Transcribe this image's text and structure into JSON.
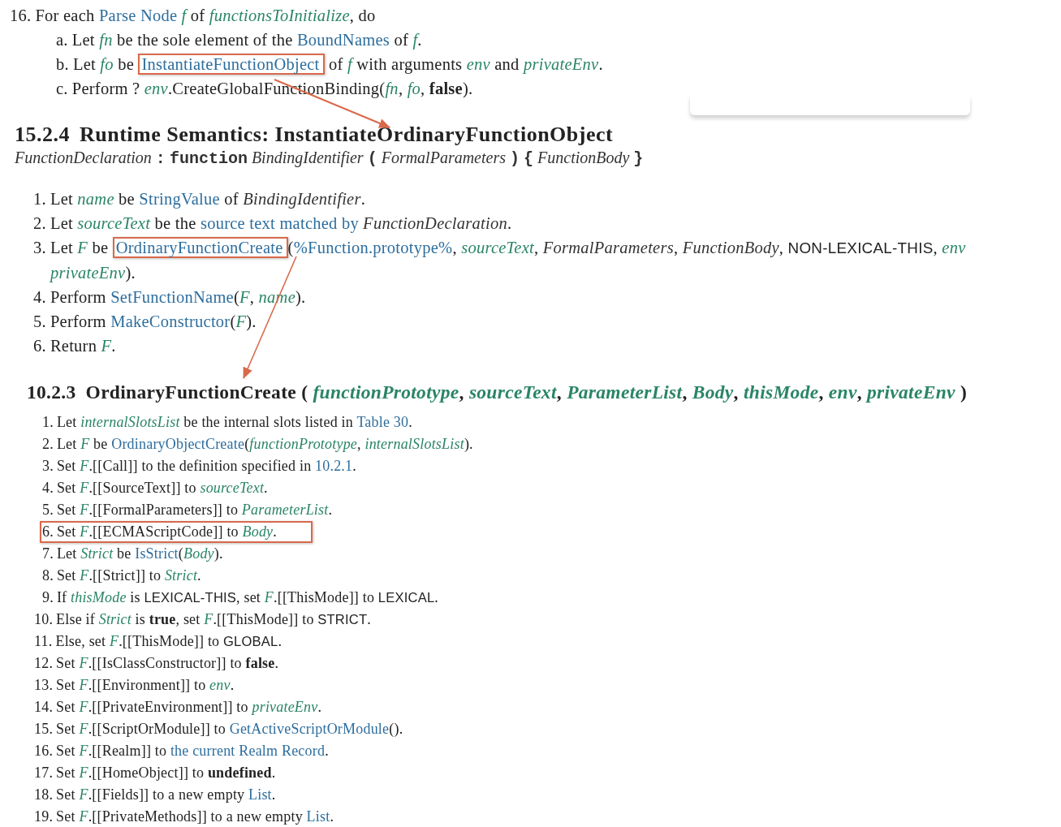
{
  "top_steps": [
    {
      "marker": "16.",
      "segments": [
        {
          "kind": "plain",
          "t": "For each "
        },
        {
          "kind": "link",
          "t": "Parse Node"
        },
        {
          "kind": "var",
          "t": "f",
          "spaced": true
        },
        {
          "kind": "plain",
          "t": " of "
        },
        {
          "kind": "var",
          "t": "functionsToInitialize"
        },
        {
          "kind": "plain",
          "t": ", do"
        }
      ],
      "children": [
        {
          "marker": "a.",
          "segments": [
            {
              "kind": "plain",
              "t": "Let "
            },
            {
              "kind": "var",
              "t": "fn"
            },
            {
              "kind": "plain",
              "t": " be the sole element of the "
            },
            {
              "kind": "link",
              "t": "BoundNames"
            },
            {
              "kind": "plain",
              "t": " of "
            },
            {
              "kind": "var",
              "t": "f"
            },
            {
              "kind": "plain",
              "t": "."
            }
          ]
        },
        {
          "marker": "b.",
          "segments": [
            {
              "kind": "plain",
              "t": "Let "
            },
            {
              "kind": "var",
              "t": "fo"
            },
            {
              "kind": "plain",
              "t": " be "
            },
            {
              "kind": "link",
              "t": "InstantiateFunctionObject",
              "boxed": true
            },
            {
              "kind": "plain",
              "t": " of "
            },
            {
              "kind": "var",
              "t": "f"
            },
            {
              "kind": "plain",
              "t": " with arguments "
            },
            {
              "kind": "var",
              "t": "env"
            },
            {
              "kind": "plain",
              "t": " and "
            },
            {
              "kind": "var",
              "t": "privateEnv"
            },
            {
              "kind": "plain",
              "t": "."
            }
          ]
        },
        {
          "marker": "c.",
          "segments": [
            {
              "kind": "plain",
              "t": "Perform ? "
            },
            {
              "kind": "var",
              "t": "env"
            },
            {
              "kind": "plain",
              "t": ".CreateGlobalFunctionBinding("
            },
            {
              "kind": "var",
              "t": "fn"
            },
            {
              "kind": "plain",
              "t": ", "
            },
            {
              "kind": "var",
              "t": "fo"
            },
            {
              "kind": "plain",
              "t": ", "
            },
            {
              "kind": "bold",
              "t": "false"
            },
            {
              "kind": "plain",
              "t": ")."
            }
          ]
        }
      ]
    }
  ],
  "section_1": {
    "heading": {
      "number": "15.2.4",
      "segments": [
        {
          "kind": "plain",
          "t": "Runtime Semantics: InstantiateOrdinaryFunctionObject"
        }
      ]
    },
    "grammar": [
      {
        "kind": "nt",
        "t": "FunctionDeclaration"
      },
      {
        "kind": "term",
        "t": ":"
      },
      {
        "kind": "term",
        "t": "function"
      },
      {
        "kind": "nt",
        "t": "BindingIdentifier"
      },
      {
        "kind": "term",
        "t": "("
      },
      {
        "kind": "nt",
        "t": "FormalParameters"
      },
      {
        "kind": "term",
        "t": ")"
      },
      {
        "kind": "term",
        "t": "{"
      },
      {
        "kind": "nt",
        "t": "FunctionBody"
      },
      {
        "kind": "term",
        "t": "}"
      }
    ],
    "steps": [
      {
        "marker": "1.",
        "segments": [
          {
            "kind": "plain",
            "t": "Let "
          },
          {
            "kind": "var",
            "t": "name"
          },
          {
            "kind": "plain",
            "t": " be "
          },
          {
            "kind": "link",
            "t": "StringValue"
          },
          {
            "kind": "plain",
            "t": " of "
          },
          {
            "kind": "it",
            "t": "BindingIdentifier"
          },
          {
            "kind": "plain",
            "t": "."
          }
        ]
      },
      {
        "marker": "2.",
        "segments": [
          {
            "kind": "plain",
            "t": "Let "
          },
          {
            "kind": "var",
            "t": "sourceText"
          },
          {
            "kind": "plain",
            "t": " be the "
          },
          {
            "kind": "link",
            "t": "source text matched by"
          },
          {
            "kind": "it",
            "t": "FunctionDeclaration",
            "spaced": true
          },
          {
            "kind": "plain",
            "t": "."
          }
        ]
      },
      {
        "marker": "3.",
        "segments": [
          {
            "kind": "plain",
            "t": "Let "
          },
          {
            "kind": "var",
            "t": "F"
          },
          {
            "kind": "plain",
            "t": " be "
          },
          {
            "kind": "link",
            "t": "OrdinaryFunctionCreate",
            "boxed": true
          },
          {
            "kind": "plain",
            "t": "("
          },
          {
            "kind": "link",
            "t": "%Function.prototype%"
          },
          {
            "kind": "plain",
            "t": ", "
          },
          {
            "kind": "var",
            "t": "sourceText"
          },
          {
            "kind": "plain",
            "t": ", "
          },
          {
            "kind": "it",
            "t": "FormalParameters"
          },
          {
            "kind": "plain",
            "t": ", "
          },
          {
            "kind": "it",
            "t": "FunctionBody"
          },
          {
            "kind": "plain",
            "t": ", "
          },
          {
            "kind": "const",
            "t": "NON-LEXICAL-THIS"
          },
          {
            "kind": "plain",
            "t": ", "
          },
          {
            "kind": "var",
            "t": "env"
          }
        ],
        "continued": [
          {
            "kind": "var",
            "t": "privateEnv"
          },
          {
            "kind": "plain",
            "t": ")."
          }
        ]
      },
      {
        "marker": "4.",
        "segments": [
          {
            "kind": "plain",
            "t": "Perform "
          },
          {
            "kind": "link",
            "t": "SetFunctionName"
          },
          {
            "kind": "plain",
            "t": "("
          },
          {
            "kind": "var",
            "t": "F"
          },
          {
            "kind": "plain",
            "t": ", "
          },
          {
            "kind": "var",
            "t": "name"
          },
          {
            "kind": "plain",
            "t": ")."
          }
        ]
      },
      {
        "marker": "5.",
        "segments": [
          {
            "kind": "plain",
            "t": "Perform "
          },
          {
            "kind": "link",
            "t": "MakeConstructor"
          },
          {
            "kind": "plain",
            "t": "("
          },
          {
            "kind": "var",
            "t": "F"
          },
          {
            "kind": "plain",
            "t": ")."
          }
        ]
      },
      {
        "marker": "6.",
        "segments": [
          {
            "kind": "plain",
            "t": "Return "
          },
          {
            "kind": "var",
            "t": "F"
          },
          {
            "kind": "plain",
            "t": "."
          }
        ]
      }
    ]
  },
  "section_2": {
    "heading": {
      "number": "10.2.3",
      "segments": [
        {
          "kind": "plain",
          "t": "OrdinaryFunctionCreate ( "
        },
        {
          "kind": "var",
          "t": "functionPrototype"
        },
        {
          "kind": "plain",
          "t": ", "
        },
        {
          "kind": "var",
          "t": "sourceText"
        },
        {
          "kind": "plain",
          "t": ", "
        },
        {
          "kind": "var",
          "t": "ParameterList"
        },
        {
          "kind": "plain",
          "t": ", "
        },
        {
          "kind": "var",
          "t": "Body"
        },
        {
          "kind": "plain",
          "t": ", "
        },
        {
          "kind": "var",
          "t": "thisMode"
        },
        {
          "kind": "plain",
          "t": ", "
        },
        {
          "kind": "var",
          "t": "env"
        },
        {
          "kind": "plain",
          "t": ", "
        },
        {
          "kind": "var",
          "t": "privateEnv"
        },
        {
          "kind": "plain",
          "t": " )"
        }
      ]
    },
    "steps": [
      {
        "marker": "1.",
        "boxed": false,
        "segments": [
          {
            "kind": "plain",
            "t": "Let "
          },
          {
            "kind": "var",
            "t": "internalSlotsList"
          },
          {
            "kind": "plain",
            "t": " be the internal slots listed in "
          },
          {
            "kind": "link",
            "t": "Table 30"
          },
          {
            "kind": "plain",
            "t": "."
          }
        ]
      },
      {
        "marker": "2.",
        "boxed": false,
        "segments": [
          {
            "kind": "plain",
            "t": "Let "
          },
          {
            "kind": "var",
            "t": "F"
          },
          {
            "kind": "plain",
            "t": " be "
          },
          {
            "kind": "link",
            "t": "OrdinaryObjectCreate"
          },
          {
            "kind": "plain",
            "t": "("
          },
          {
            "kind": "var",
            "t": "functionPrototype"
          },
          {
            "kind": "plain",
            "t": ", "
          },
          {
            "kind": "var",
            "t": "internalSlotsList"
          },
          {
            "kind": "plain",
            "t": ")."
          }
        ]
      },
      {
        "marker": "3.",
        "boxed": false,
        "segments": [
          {
            "kind": "plain",
            "t": "Set "
          },
          {
            "kind": "var",
            "t": "F"
          },
          {
            "kind": "plain",
            "t": ".[[Call]] to the definition specified in "
          },
          {
            "kind": "link",
            "t": "10.2.1"
          },
          {
            "kind": "plain",
            "t": "."
          }
        ]
      },
      {
        "marker": "4.",
        "boxed": false,
        "segments": [
          {
            "kind": "plain",
            "t": "Set "
          },
          {
            "kind": "var",
            "t": "F"
          },
          {
            "kind": "plain",
            "t": ".[[SourceText]] to "
          },
          {
            "kind": "var",
            "t": "sourceText"
          },
          {
            "kind": "plain",
            "t": "."
          }
        ]
      },
      {
        "marker": "5.",
        "boxed": false,
        "segments": [
          {
            "kind": "plain",
            "t": "Set "
          },
          {
            "kind": "var",
            "t": "F"
          },
          {
            "kind": "plain",
            "t": ".[[FormalParameters]] to "
          },
          {
            "kind": "var",
            "t": "ParameterList"
          },
          {
            "kind": "plain",
            "t": "."
          }
        ]
      },
      {
        "marker": "6.",
        "boxed": true,
        "segments": [
          {
            "kind": "plain",
            "t": "Set "
          },
          {
            "kind": "var",
            "t": "F"
          },
          {
            "kind": "plain",
            "t": ".[[ECMAScriptCode]] to "
          },
          {
            "kind": "var",
            "t": "Body"
          },
          {
            "kind": "plain",
            "t": "."
          }
        ]
      },
      {
        "marker": "7.",
        "boxed": false,
        "segments": [
          {
            "kind": "plain",
            "t": "Let "
          },
          {
            "kind": "var",
            "t": "Strict"
          },
          {
            "kind": "plain",
            "t": " be "
          },
          {
            "kind": "link",
            "t": "IsStrict"
          },
          {
            "kind": "plain",
            "t": "("
          },
          {
            "kind": "var",
            "t": "Body"
          },
          {
            "kind": "plain",
            "t": ")."
          }
        ]
      },
      {
        "marker": "8.",
        "boxed": false,
        "segments": [
          {
            "kind": "plain",
            "t": "Set "
          },
          {
            "kind": "var",
            "t": "F"
          },
          {
            "kind": "plain",
            "t": ".[[Strict]] to "
          },
          {
            "kind": "var",
            "t": "Strict"
          },
          {
            "kind": "plain",
            "t": "."
          }
        ]
      },
      {
        "marker": "9.",
        "boxed": false,
        "segments": [
          {
            "kind": "plain",
            "t": "If "
          },
          {
            "kind": "var",
            "t": "thisMode"
          },
          {
            "kind": "plain",
            "t": " is "
          },
          {
            "kind": "const",
            "t": "LEXICAL-THIS"
          },
          {
            "kind": "plain",
            "t": ", set "
          },
          {
            "kind": "var",
            "t": "F"
          },
          {
            "kind": "plain",
            "t": ".[[ThisMode]] to "
          },
          {
            "kind": "const",
            "t": "LEXICAL"
          },
          {
            "kind": "plain",
            "t": "."
          }
        ]
      },
      {
        "marker": "10.",
        "boxed": false,
        "segments": [
          {
            "kind": "plain",
            "t": "Else if "
          },
          {
            "kind": "var",
            "t": "Strict"
          },
          {
            "kind": "plain",
            "t": " is "
          },
          {
            "kind": "bold",
            "t": "true"
          },
          {
            "kind": "plain",
            "t": ", set "
          },
          {
            "kind": "var",
            "t": "F"
          },
          {
            "kind": "plain",
            "t": ".[[ThisMode]] to "
          },
          {
            "kind": "const",
            "t": "STRICT"
          },
          {
            "kind": "plain",
            "t": "."
          }
        ]
      },
      {
        "marker": "11.",
        "boxed": false,
        "segments": [
          {
            "kind": "plain",
            "t": "Else, set "
          },
          {
            "kind": "var",
            "t": "F"
          },
          {
            "kind": "plain",
            "t": ".[[ThisMode]] to "
          },
          {
            "kind": "const",
            "t": "GLOBAL"
          },
          {
            "kind": "plain",
            "t": "."
          }
        ]
      },
      {
        "marker": "12.",
        "boxed": false,
        "segments": [
          {
            "kind": "plain",
            "t": "Set "
          },
          {
            "kind": "var",
            "t": "F"
          },
          {
            "kind": "plain",
            "t": ".[[IsClassConstructor]] to "
          },
          {
            "kind": "bold",
            "t": "false"
          },
          {
            "kind": "plain",
            "t": "."
          }
        ]
      },
      {
        "marker": "13.",
        "boxed": false,
        "segments": [
          {
            "kind": "plain",
            "t": "Set "
          },
          {
            "kind": "var",
            "t": "F"
          },
          {
            "kind": "plain",
            "t": ".[[Environment]] to "
          },
          {
            "kind": "var",
            "t": "env"
          },
          {
            "kind": "plain",
            "t": "."
          }
        ]
      },
      {
        "marker": "14.",
        "boxed": false,
        "segments": [
          {
            "kind": "plain",
            "t": "Set "
          },
          {
            "kind": "var",
            "t": "F"
          },
          {
            "kind": "plain",
            "t": ".[[PrivateEnvironment]] to "
          },
          {
            "kind": "var",
            "t": "privateEnv"
          },
          {
            "kind": "plain",
            "t": "."
          }
        ]
      },
      {
        "marker": "15.",
        "boxed": false,
        "segments": [
          {
            "kind": "plain",
            "t": "Set "
          },
          {
            "kind": "var",
            "t": "F"
          },
          {
            "kind": "plain",
            "t": ".[[ScriptOrModule]] to "
          },
          {
            "kind": "link",
            "t": "GetActiveScriptOrModule"
          },
          {
            "kind": "plain",
            "t": "()."
          }
        ]
      },
      {
        "marker": "16.",
        "boxed": false,
        "segments": [
          {
            "kind": "plain",
            "t": "Set "
          },
          {
            "kind": "var",
            "t": "F"
          },
          {
            "kind": "plain",
            "t": ".[[Realm]] to "
          },
          {
            "kind": "link",
            "t": "the current Realm Record"
          },
          {
            "kind": "plain",
            "t": "."
          }
        ]
      },
      {
        "marker": "17.",
        "boxed": false,
        "segments": [
          {
            "kind": "plain",
            "t": "Set "
          },
          {
            "kind": "var",
            "t": "F"
          },
          {
            "kind": "plain",
            "t": ".[[HomeObject]] to "
          },
          {
            "kind": "bold",
            "t": "undefined"
          },
          {
            "kind": "plain",
            "t": "."
          }
        ]
      },
      {
        "marker": "18.",
        "boxed": false,
        "segments": [
          {
            "kind": "plain",
            "t": "Set "
          },
          {
            "kind": "var",
            "t": "F"
          },
          {
            "kind": "plain",
            "t": ".[[Fields]] to a new empty "
          },
          {
            "kind": "link",
            "t": "List"
          },
          {
            "kind": "plain",
            "t": "."
          }
        ]
      },
      {
        "marker": "19.",
        "boxed": false,
        "segments": [
          {
            "kind": "plain",
            "t": "Set "
          },
          {
            "kind": "var",
            "t": "F"
          },
          {
            "kind": "plain",
            "t": ".[[PrivateMethods]] to a new empty "
          },
          {
            "kind": "link",
            "t": "List"
          },
          {
            "kind": "plain",
            "t": "."
          }
        ]
      }
    ]
  }
}
